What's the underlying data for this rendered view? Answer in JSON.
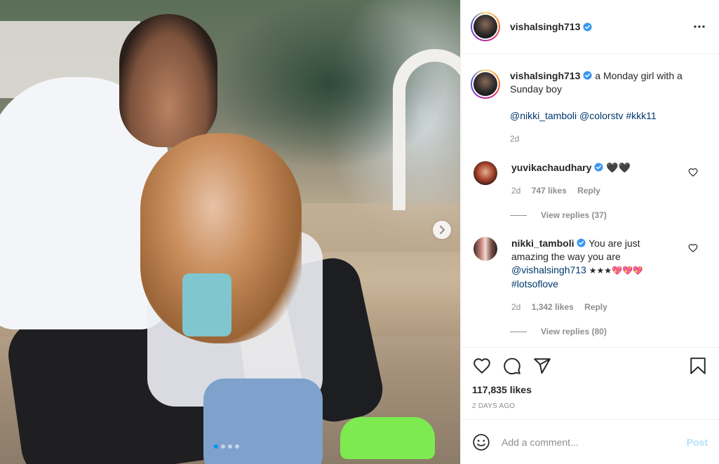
{
  "post": {
    "username": "vishalsingh713",
    "caption_text": "a Monday girl with a Sunday boy",
    "mentions": [
      "@nikki_tamboli",
      "@colorstv",
      "#kkk11"
    ],
    "caption_age": "2d"
  },
  "icons": {
    "verified": "verified-badge-icon",
    "more": "more-options-icon",
    "next": "chevron-right-icon",
    "like": "heart-icon",
    "comment": "comment-icon",
    "share": "share-icon",
    "save": "bookmark-icon",
    "emoji": "emoji-icon"
  },
  "colors": {
    "verified": "#3897f0",
    "link": "#00376b",
    "post_button": "#b2dffc",
    "active_dot": "#0095f6"
  },
  "comments": [
    {
      "username": "yuvikachaudhary",
      "text": "🖤🖤",
      "age": "2d",
      "likes": "747 likes",
      "reply_label": "Reply",
      "view_replies": "View replies (37)"
    },
    {
      "username": "nikki_tamboli",
      "text": "You are just amazing the way you are",
      "mention": "@vishalsingh713",
      "emojis": "★★★💖💖💖",
      "hashtag": "#lotsoflove",
      "age": "2d",
      "likes": "1,342 likes",
      "reply_label": "Reply",
      "view_replies": "View replies (80)"
    }
  ],
  "actions": {
    "likes": "117,835 likes",
    "time": "2 DAYS AGO"
  },
  "add_comment": {
    "placeholder": "Add a comment...",
    "post_label": "Post"
  },
  "carousel": {
    "slides": 4,
    "current": 1
  }
}
